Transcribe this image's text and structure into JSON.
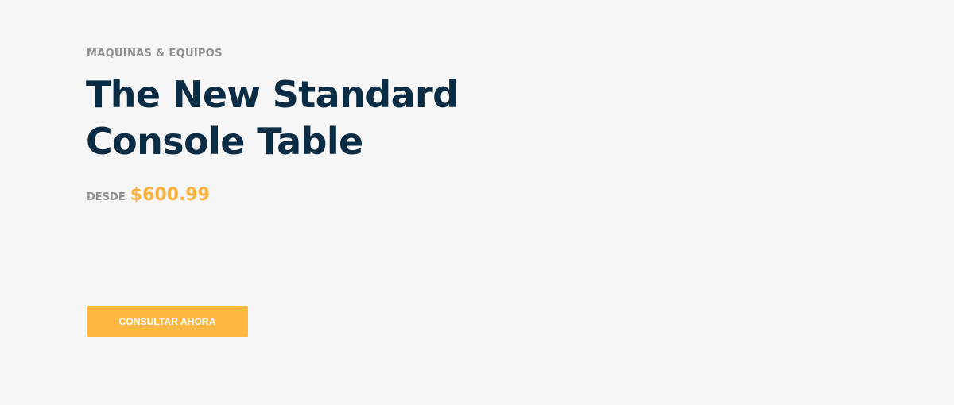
{
  "hero": {
    "category": "MAQUINAS & EQUIPOS",
    "title_line1": "The New Standard",
    "title_line2": "Console Table",
    "price_prefix": "DESDE",
    "price": "$600.99",
    "cta_label": "CONSULTAR AHORA"
  },
  "colors": {
    "background": "#f6f6f6",
    "title": "#0b2c45",
    "muted_text": "#8e8e8e",
    "accent": "#fbb13c",
    "button": "#fdb63f"
  }
}
